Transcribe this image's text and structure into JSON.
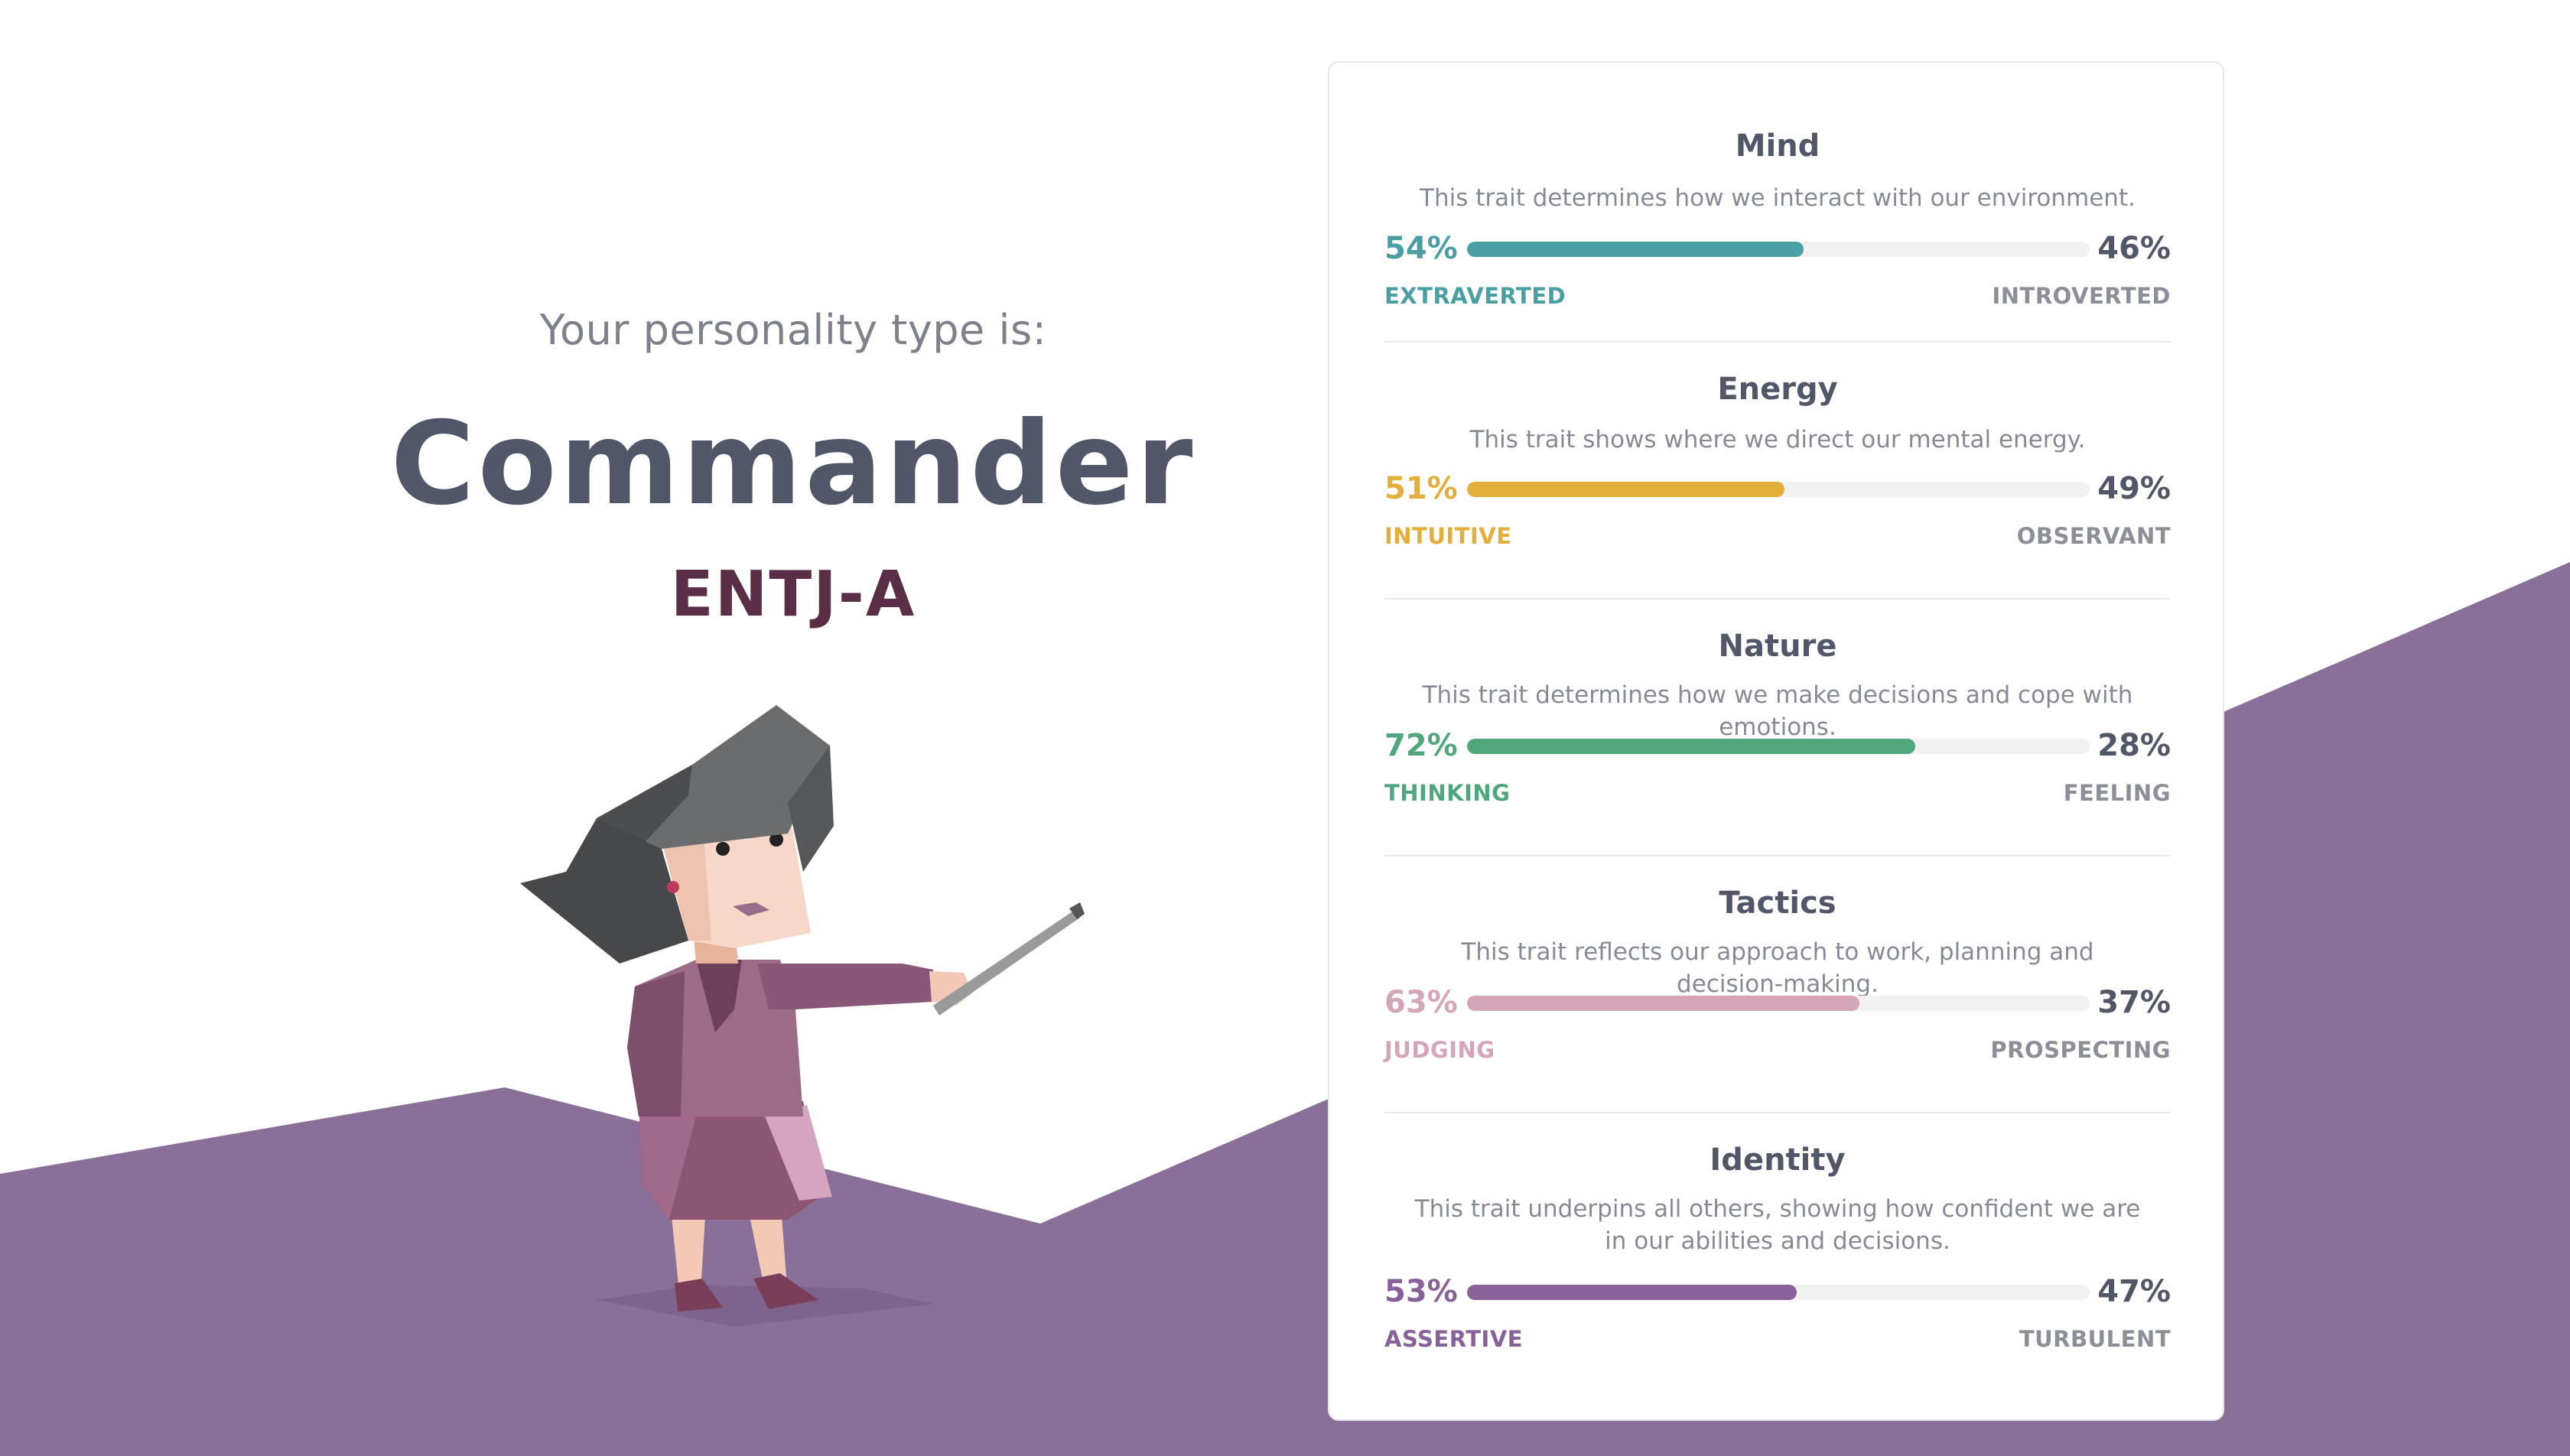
{
  "header": {
    "intro": "Your personality type is:",
    "type_name": "Commander",
    "type_code": "ENTJ-A"
  },
  "colors": {
    "background_accent": "#8a7099",
    "type_code": "#5b2e47",
    "heading": "#4f5769"
  },
  "traits": [
    {
      "title": "Mind",
      "description": "This trait determines how we interact with our environment.",
      "left_percent": "54%",
      "right_percent": "46%",
      "left_label": "EXTRAVERTED",
      "right_label": "INTROVERTED",
      "fill_fraction": 0.54,
      "color": "#4a9fa5"
    },
    {
      "title": "Energy",
      "description": "This trait shows where we direct our mental energy.",
      "left_percent": "51%",
      "right_percent": "49%",
      "left_label": "INTUITIVE",
      "right_label": "OBSERVANT",
      "fill_fraction": 0.51,
      "color": "#e4ae3a"
    },
    {
      "title": "Nature",
      "description": "This trait determines how we make decisions and cope with emotions.",
      "left_percent": "72%",
      "right_percent": "28%",
      "left_label": "THINKING",
      "right_label": "FEELING",
      "fill_fraction": 0.72,
      "color": "#4fa87c"
    },
    {
      "title": "Tactics",
      "description": "This trait reflects our approach to work, planning and decision-making.",
      "left_percent": "63%",
      "right_percent": "37%",
      "left_label": "JUDGING",
      "right_label": "PROSPECTING",
      "fill_fraction": 0.63,
      "color": "#d4a4b8"
    },
    {
      "title": "Identity",
      "description": "This trait underpins all others, showing how confident we are in our abilities and decisions.",
      "left_percent": "53%",
      "right_percent": "47%",
      "left_label": "ASSERTIVE",
      "right_label": "TURBULENT",
      "fill_fraction": 0.53,
      "color": "#88619a"
    }
  ],
  "illustration": {
    "icon": "commander-character-illustration"
  }
}
